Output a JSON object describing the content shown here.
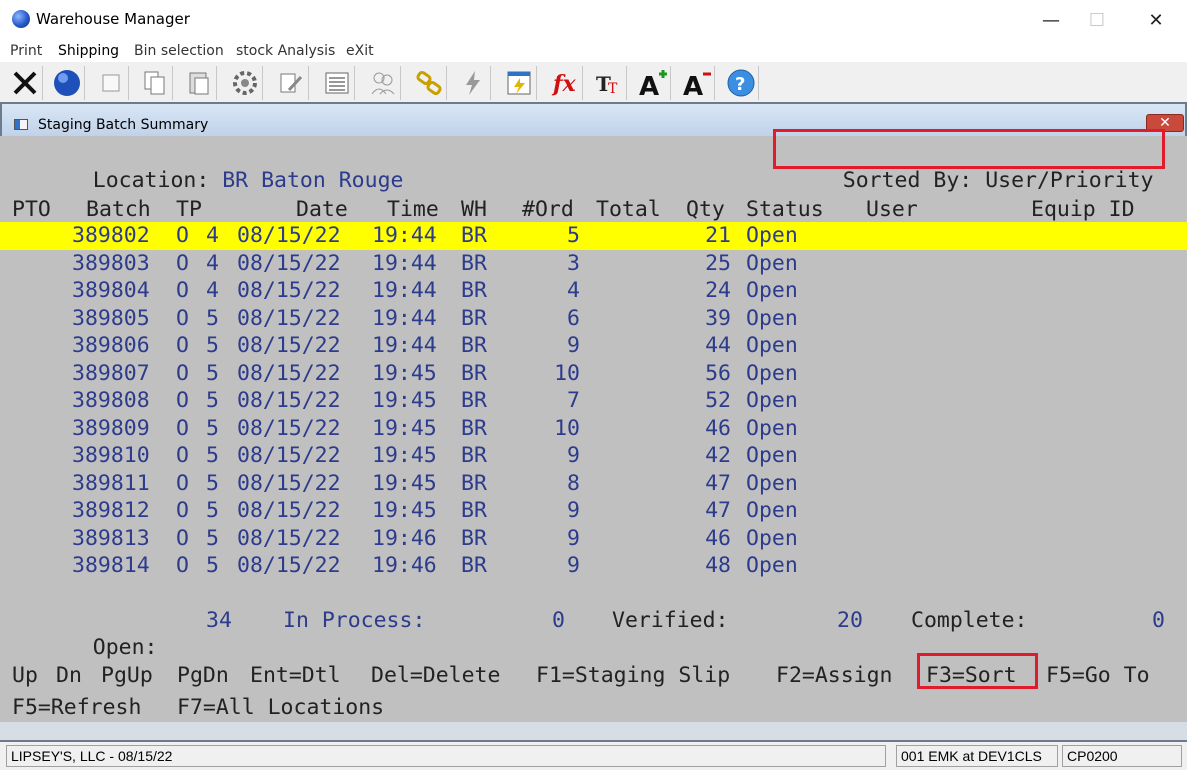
{
  "window": {
    "title": "Warehouse Manager"
  },
  "menu": [
    {
      "label": "Print",
      "bold": false
    },
    {
      "label": "Shipping",
      "bold": true
    },
    {
      "label": "Bin selection",
      "bold": false
    },
    {
      "label": "stock Analysis",
      "bold": false
    },
    {
      "label": "eXit",
      "bold": false
    }
  ],
  "toolbar_icons": [
    "close-x-icon",
    "globe-icon",
    "blank-icon",
    "copy-icon",
    "paste-icon",
    "settings-icon",
    "edit-icon",
    "list-icon",
    "people-icon",
    "link-icon",
    "lightning-icon",
    "report-icon",
    "function-icon",
    "font-size-icon",
    "font-grow-icon",
    "font-shrink-icon",
    "help-icon"
  ],
  "inner_window": {
    "title": "Staging Batch Summary"
  },
  "location": {
    "label": "Location:",
    "value": "BR Baton Rouge"
  },
  "sort": {
    "label": "Sorted By:",
    "value": "User/Priority"
  },
  "columns": [
    "PTO",
    "Batch",
    "TP",
    "Date",
    "Time",
    "WH",
    "#Ord",
    "Total",
    "Qty",
    "Status",
    "User",
    "Equip ID"
  ],
  "rows": [
    {
      "batch": "389802",
      "t": "O",
      "p": "4",
      "date": "08/15/22",
      "time": "19:44",
      "wh": "BR",
      "ord": "5",
      "qty": "21",
      "status": "Open"
    },
    {
      "batch": "389803",
      "t": "O",
      "p": "4",
      "date": "08/15/22",
      "time": "19:44",
      "wh": "BR",
      "ord": "3",
      "qty": "25",
      "status": "Open"
    },
    {
      "batch": "389804",
      "t": "O",
      "p": "4",
      "date": "08/15/22",
      "time": "19:44",
      "wh": "BR",
      "ord": "4",
      "qty": "24",
      "status": "Open"
    },
    {
      "batch": "389805",
      "t": "O",
      "p": "5",
      "date": "08/15/22",
      "time": "19:44",
      "wh": "BR",
      "ord": "6",
      "qty": "39",
      "status": "Open"
    },
    {
      "batch": "389806",
      "t": "O",
      "p": "5",
      "date": "08/15/22",
      "time": "19:44",
      "wh": "BR",
      "ord": "9",
      "qty": "44",
      "status": "Open"
    },
    {
      "batch": "389807",
      "t": "O",
      "p": "5",
      "date": "08/15/22",
      "time": "19:45",
      "wh": "BR",
      "ord": "10",
      "qty": "56",
      "status": "Open"
    },
    {
      "batch": "389808",
      "t": "O",
      "p": "5",
      "date": "08/15/22",
      "time": "19:45",
      "wh": "BR",
      "ord": "7",
      "qty": "52",
      "status": "Open"
    },
    {
      "batch": "389809",
      "t": "O",
      "p": "5",
      "date": "08/15/22",
      "time": "19:45",
      "wh": "BR",
      "ord": "10",
      "qty": "46",
      "status": "Open"
    },
    {
      "batch": "389810",
      "t": "O",
      "p": "5",
      "date": "08/15/22",
      "time": "19:45",
      "wh": "BR",
      "ord": "9",
      "qty": "42",
      "status": "Open"
    },
    {
      "batch": "389811",
      "t": "O",
      "p": "5",
      "date": "08/15/22",
      "time": "19:45",
      "wh": "BR",
      "ord": "8",
      "qty": "47",
      "status": "Open"
    },
    {
      "batch": "389812",
      "t": "O",
      "p": "5",
      "date": "08/15/22",
      "time": "19:45",
      "wh": "BR",
      "ord": "9",
      "qty": "47",
      "status": "Open"
    },
    {
      "batch": "389813",
      "t": "O",
      "p": "5",
      "date": "08/15/22",
      "time": "19:46",
      "wh": "BR",
      "ord": "9",
      "qty": "46",
      "status": "Open"
    },
    {
      "batch": "389814",
      "t": "O",
      "p": "5",
      "date": "08/15/22",
      "time": "19:46",
      "wh": "BR",
      "ord": "9",
      "qty": "48",
      "status": "Open"
    }
  ],
  "selected_row": 0,
  "summary": {
    "open_label": "Open:",
    "open_value": "34",
    "inprocess_label": "In Process:",
    "inprocess_value": "0",
    "verified_label": "Verified:",
    "verified_value": "20",
    "complete_label": "Complete:",
    "complete_value": "0"
  },
  "commands": [
    "Up",
    "Dn",
    "PgUp",
    "PgDn",
    "Ent=Dtl",
    "Del=Delete",
    "F1=Staging Slip",
    "F2=Assign",
    "F3=Sort",
    "F5=Go To"
  ],
  "commands2": [
    "F5=Refresh",
    "F7=All Locations"
  ],
  "statusbar": {
    "company": "LIPSEY'S, LLC - 08/15/22",
    "user": "001 EMK at DEV1CLS",
    "code": "CP0200"
  },
  "colors": {
    "selected_row": "#ffff00",
    "highlight": "#e21b2c",
    "text_blue": "#2c3b8c",
    "terminal_bg": "#c0c0c0"
  }
}
